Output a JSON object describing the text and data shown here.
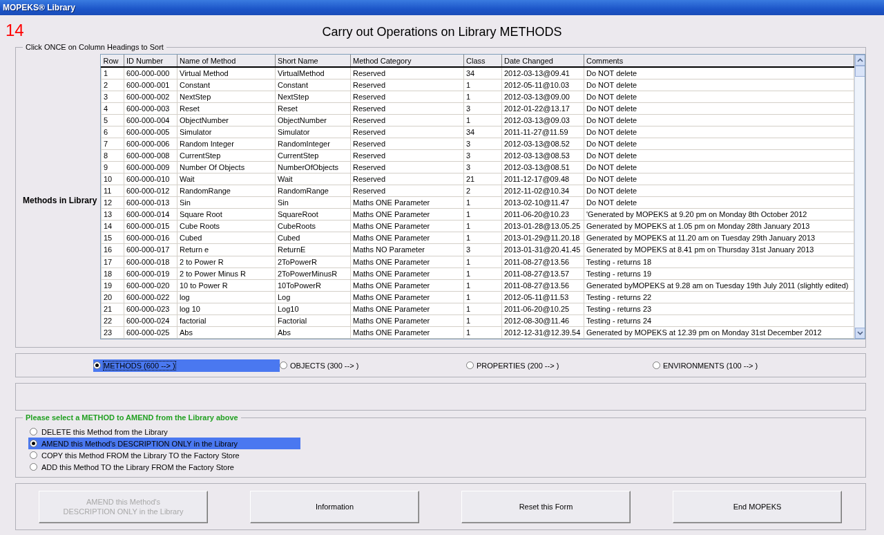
{
  "window": {
    "title": "MOPEKS® Library"
  },
  "header": {
    "number": "14",
    "title": "Carry out Operations on Library METHODS"
  },
  "library_group": {
    "legend": "Click ONCE on Column Headings to Sort",
    "side_label": "Methods in Library"
  },
  "table": {
    "columns": [
      "Row",
      "ID Number",
      "Name of Method",
      "Short Name",
      "Method Category",
      "Class",
      "Date Changed",
      "Comments"
    ],
    "rows": [
      [
        "1",
        "600-000-000",
        "Virtual Method",
        "VirtualMethod",
        "Reserved",
        "34",
        "2012-03-13@09.41",
        "Do NOT delete"
      ],
      [
        "2",
        "600-000-001",
        "Constant",
        "Constant",
        "Reserved",
        "1",
        "2012-05-11@10.03",
        "Do NOT delete"
      ],
      [
        "3",
        "600-000-002",
        "NextStep",
        "NextStep",
        "Reserved",
        "1",
        "2012-03-13@09.00",
        "Do NOT delete"
      ],
      [
        "4",
        "600-000-003",
        "Reset",
        "Reset",
        "Reserved",
        "3",
        "2012-01-22@13.17",
        "Do NOT delete"
      ],
      [
        "5",
        "600-000-004",
        "ObjectNumber",
        "ObjectNumber",
        "Reserved",
        "1",
        "2012-03-13@09.03",
        "Do NOT delete"
      ],
      [
        "6",
        "600-000-005",
        "Simulator",
        "Simulator",
        "Reserved",
        "34",
        "2011-11-27@11.59",
        "Do NOT delete"
      ],
      [
        "7",
        "600-000-006",
        "Random Integer",
        "RandomInteger",
        "Reserved",
        "3",
        "2012-03-13@08.52",
        "Do NOT delete"
      ],
      [
        "8",
        "600-000-008",
        "CurrentStep",
        "CurrentStep",
        "Reserved",
        "3",
        "2012-03-13@08.53",
        "Do NOT delete"
      ],
      [
        "9",
        "600-000-009",
        "Number Of Objects",
        "NumberOfObjects",
        "Reserved",
        "3",
        "2012-03-13@08.51",
        "Do NOT delete"
      ],
      [
        "10",
        "600-000-010",
        "Wait",
        "Wait",
        "Reserved",
        "21",
        "2011-12-17@09.48",
        "Do NOT delete"
      ],
      [
        "11",
        "600-000-012",
        "RandomRange",
        "RandomRange",
        "Reserved",
        "2",
        "2012-11-02@10.34",
        "Do NOT delete"
      ],
      [
        "12",
        "600-000-013",
        "Sin",
        "Sin",
        "Maths ONE Parameter",
        "1",
        "2013-02-10@11.47",
        "Do NOT delete"
      ],
      [
        "13",
        "600-000-014",
        "Square Root",
        "SquareRoot",
        "Maths ONE Parameter",
        "1",
        "2011-06-20@10.23",
        "'Generated by MOPEKS at 9.20 pm on Monday 8th October 2012"
      ],
      [
        "14",
        "600-000-015",
        "Cube Roots",
        "CubeRoots",
        "Maths ONE Parameter",
        "1",
        "2013-01-28@13.05.25",
        "Generated by MOPEKS at 1.05 pm on Monday 28th January 2013"
      ],
      [
        "15",
        "600-000-016",
        "Cubed",
        "Cubed",
        "Maths ONE Parameter",
        "1",
        "2013-01-29@11.20.18",
        "Generated by MOPEKS at 11.20 am on Tuesday 29th January 2013"
      ],
      [
        "16",
        "600-000-017",
        "Return e",
        "ReturnE",
        "Maths NO Parameter",
        "3",
        "2013-01-31@20.41.45",
        "Generated by MOPEKS at 8.41 pm on Thursday 31st January 2013"
      ],
      [
        "17",
        "600-000-018",
        "2 to Power R",
        "2ToPowerR",
        "Maths ONE Parameter",
        "1",
        "2011-08-27@13.56",
        "Testing - returns 18"
      ],
      [
        "18",
        "600-000-019",
        "2 to Power Minus R",
        "2ToPowerMinusR",
        "Maths ONE Parameter",
        "1",
        "2011-08-27@13.57",
        "Testing - returns 19"
      ],
      [
        "19",
        "600-000-020",
        "10 to Power R",
        "10ToPowerR",
        "Maths ONE Parameter",
        "1",
        "2011-08-27@13.56",
        "Generated byMOPEKS at 9.28 am on Tuesday 19th July 2011 (slightly edited)"
      ],
      [
        "20",
        "600-000-022",
        "log",
        "Log",
        "Maths ONE Parameter",
        "1",
        "2012-05-11@11.53",
        "Testing - returns 22"
      ],
      [
        "21",
        "600-000-023",
        "log 10",
        "Log10",
        "Maths ONE Parameter",
        "1",
        "2011-06-20@10.25",
        "Testing - returns 23"
      ],
      [
        "22",
        "600-000-024",
        "factorial",
        "Factorial",
        "Maths ONE Parameter",
        "1",
        "2012-08-30@11.46",
        "Testing - returns 24"
      ],
      [
        "23",
        "600-000-025",
        "Abs",
        "Abs",
        "Maths ONE Parameter",
        "1",
        "2012-12-31@12.39.54",
        "Generated by MOPEKS at 12.39 pm on Monday 31st December 2012"
      ]
    ]
  },
  "library_types": [
    {
      "label": "METHODS (600 --> )",
      "selected": true
    },
    {
      "label": "OBJECTS (300 --> )",
      "selected": false
    },
    {
      "label": "PROPERTIES (200 --> )",
      "selected": false
    },
    {
      "label": "ENVIRONMENTS (100 --> )",
      "selected": false
    }
  ],
  "action_group": {
    "legend": "Please select a METHOD to AMEND from the Library above",
    "options": [
      {
        "label": "DELETE this Method from the Library",
        "selected": false
      },
      {
        "label": "AMEND this Method's DESCRIPTION ONLY in the Library",
        "selected": true
      },
      {
        "label": "COPY this Method FROM the Library TO the Factory Store",
        "selected": false
      },
      {
        "label": "ADD this Method TO the Library FROM the Factory Store",
        "selected": false
      }
    ]
  },
  "buttons": [
    {
      "label": "AMEND this Method's\nDESCRIPTION ONLY in the Library",
      "disabled": true
    },
    {
      "label": "Information",
      "disabled": false
    },
    {
      "label": "Reset this Form",
      "disabled": false
    },
    {
      "label": "End MOPEKS",
      "disabled": false
    }
  ]
}
